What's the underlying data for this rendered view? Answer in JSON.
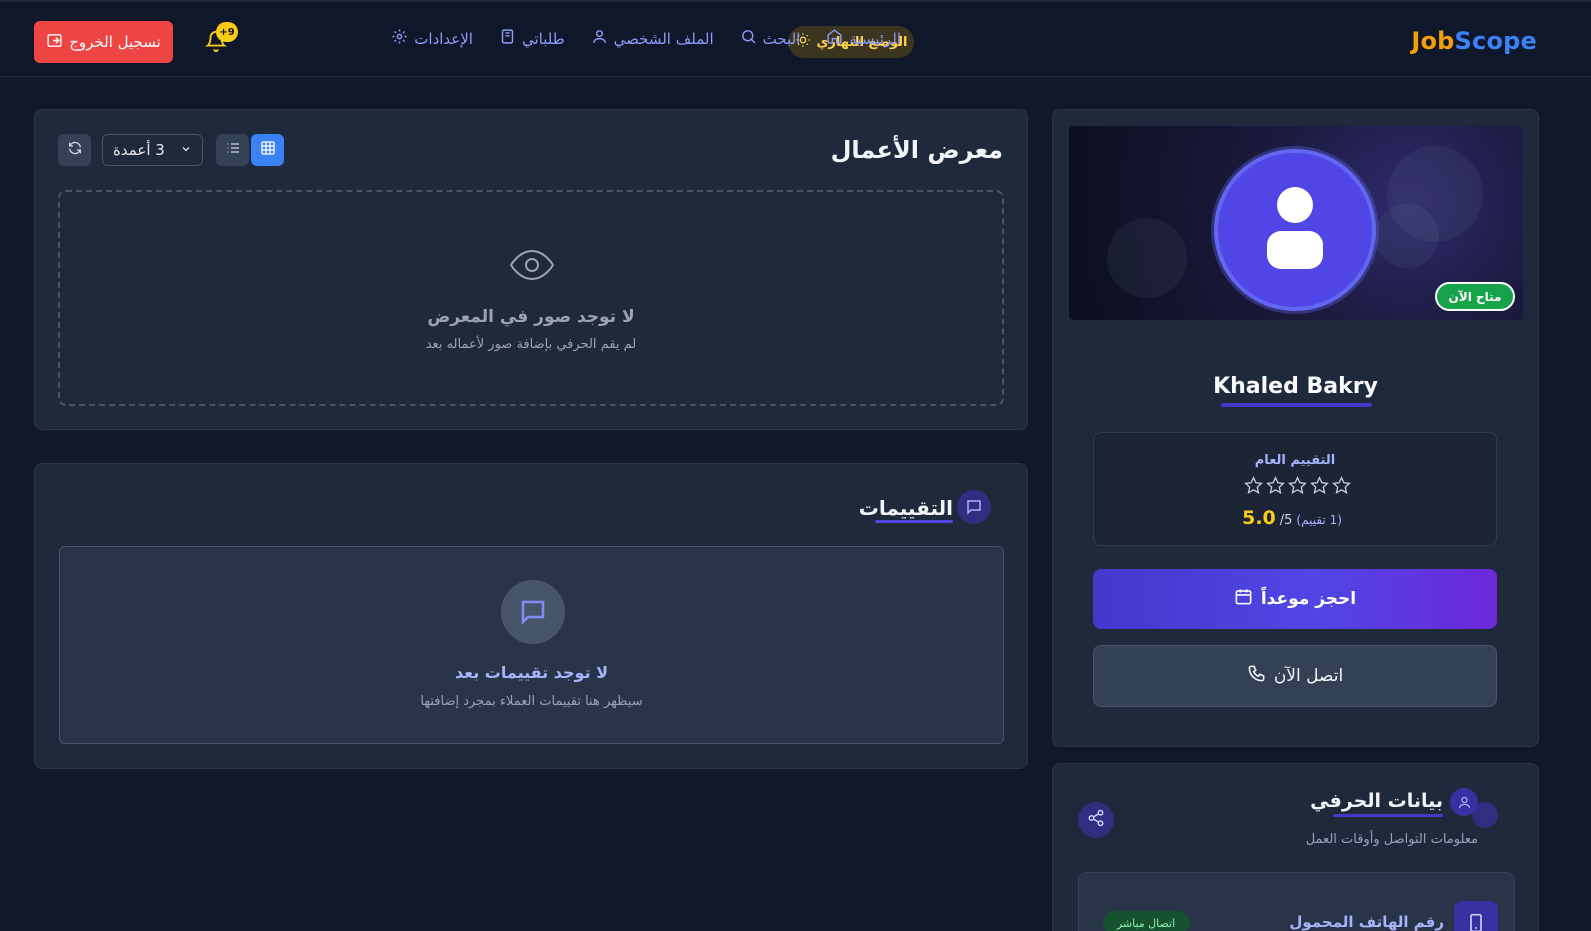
{
  "header": {
    "logo_part1": "Job",
    "logo_part2": "Scope",
    "nav": [
      {
        "label": "الرئيسية",
        "icon": "home-icon"
      },
      {
        "label": "البحث",
        "icon": "search-icon"
      },
      {
        "label": "الملف الشخصي",
        "icon": "user-icon"
      },
      {
        "label": "طلباتي",
        "icon": "book-icon"
      },
      {
        "label": "الإعدادات",
        "icon": "gear-icon"
      }
    ],
    "mode_label": "الوضع النهاري",
    "notification_count": "+9",
    "logout_label": "تسجيل الخروج"
  },
  "gallery": {
    "title": "معرض الأعمال",
    "columns_value": "3 أعمدة",
    "empty_title": "لا توجد صور في المعرض",
    "empty_sub": "لم يقم الحرفي بإضافة صور لأعماله بعد"
  },
  "reviews": {
    "title": "التقييمات",
    "empty_title": "لا توجد تقييمات بعد",
    "empty_sub": "سيظهر هنا تقييمات العملاء بمجرد إضافتها"
  },
  "profile": {
    "status": "متاح الآن",
    "name": "Khaled Bakry",
    "rating_label": "التقييم العام",
    "rating_score": "5.0",
    "rating_max": "/5",
    "rating_count": "(1 تقييم)",
    "stars_filled": 0,
    "stars_total": 5,
    "book_label": "احجز موعداً",
    "call_label": "اتصل الآن"
  },
  "info": {
    "title": "بيانات الحرفي",
    "subtitle": "معلومات التواصل وأوقات العمل",
    "phone_label": "رقم الهاتف المحمول",
    "live_badge": "اتصال مباشر"
  },
  "colors": {
    "accent": "#4f46e5",
    "primary_blue": "#3b82f6",
    "logout_red": "#ef4444",
    "available_green": "#16a34a",
    "star_yellow": "#facc15"
  }
}
